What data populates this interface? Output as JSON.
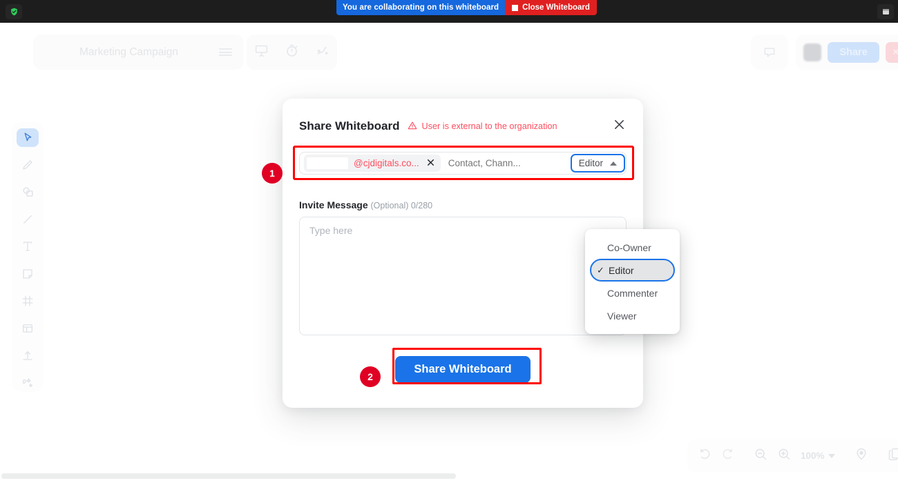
{
  "browser_bar": {
    "shield_icon": "shield-check-icon",
    "right_icon": "window-icon",
    "collab_message": "You are collaborating on this whiteboard",
    "close_whiteboard_label": "Close Whiteboard"
  },
  "app_header": {
    "board_title": "Marketing Campaign",
    "menu_icon": "hamburger-menu-icon",
    "tools": [
      "presentation-icon",
      "timer-icon",
      "laser-pointer-icon"
    ],
    "chat_icon": "chat-bubble-icon",
    "share_label": "Share",
    "close_label": "×"
  },
  "tool_rail": [
    {
      "name": "select-tool",
      "icon": "cursor-icon",
      "active": true
    },
    {
      "name": "pen-tool",
      "icon": "pencil-icon",
      "active": false
    },
    {
      "name": "shape-tool",
      "icon": "shapes-icon",
      "active": false
    },
    {
      "name": "line-tool",
      "icon": "line-icon",
      "active": false
    },
    {
      "name": "text-tool",
      "icon": "text-icon",
      "active": false
    },
    {
      "name": "note-tool",
      "icon": "sticky-note-icon",
      "active": false
    },
    {
      "name": "frame-tool",
      "icon": "frame-icon",
      "active": false
    },
    {
      "name": "template-tool",
      "icon": "layout-icon",
      "active": false
    },
    {
      "name": "upload-tool",
      "icon": "upload-icon",
      "active": false
    },
    {
      "name": "ai-tool",
      "icon": "magic-wand-icon",
      "active": false
    }
  ],
  "zoom_bar": {
    "undo_icon": "undo-icon",
    "redo_icon": "redo-icon",
    "zoom_out_icon": "zoom-out-icon",
    "zoom_in_icon": "zoom-in-icon",
    "zoom_level": "100%",
    "locate_icon": "location-pin-icon",
    "duplicate_icon": "copy-icon"
  },
  "dialog": {
    "title": "Share Whiteboard",
    "warning": "User is external to the organization",
    "warning_icon": "warning-triangle-icon",
    "close_icon": "close-icon",
    "recipients": {
      "chip_email": "@cjdigitals.co...",
      "chip_remove_icon": "remove-chip-icon",
      "input_placeholder": "Contact, Chann...",
      "input_value": "",
      "role_selected": "Editor",
      "role_caret_icon": "chevron-up-icon"
    },
    "role_menu": {
      "options": [
        {
          "label": "Co-Owner",
          "selected": false
        },
        {
          "label": "Editor",
          "selected": true
        },
        {
          "label": "Commenter",
          "selected": false
        },
        {
          "label": "Viewer",
          "selected": false
        }
      ],
      "check_glyph": "✓"
    },
    "invite_message": {
      "label": "Invite Message",
      "optional": "(Optional) 0/280",
      "placeholder": "Type here",
      "value": ""
    },
    "submit_label": "Share Whiteboard"
  },
  "annotations": {
    "badge_1": "1",
    "badge_2": "2"
  },
  "colors": {
    "accent_blue": "#1a73e8",
    "banner_blue": "#1568dd",
    "banner_red": "#e02020",
    "warning_red": "#ff4d5e",
    "highlight_red": "#ff0000",
    "badge_red": "#e00024",
    "topbar_dark": "#1d1d1d"
  }
}
